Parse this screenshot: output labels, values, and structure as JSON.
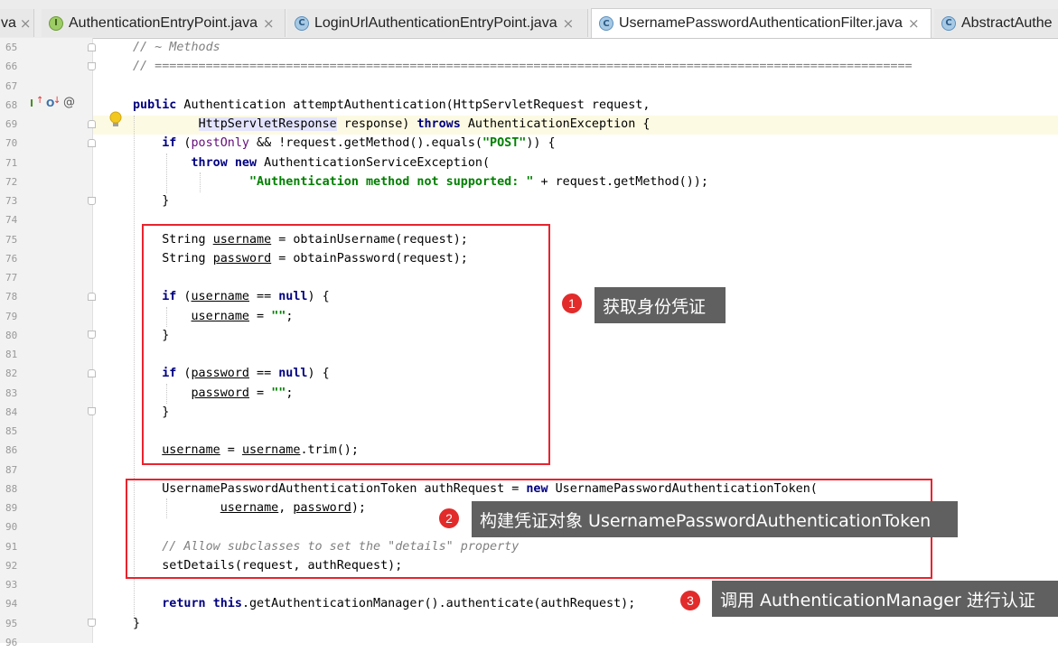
{
  "tabs": [
    {
      "label": "va",
      "icon": "none",
      "active": false
    },
    {
      "label": "AuthenticationEntryPoint.java",
      "icon": "interface-icon",
      "icon_letter": "I",
      "active": false
    },
    {
      "label": "LoginUrlAuthenticationEntryPoint.java",
      "icon": "class-icon",
      "icon_letter": "C",
      "active": false
    },
    {
      "label": "UsernamePasswordAuthenticationFilter.java",
      "icon": "class-icon",
      "icon_letter": "C",
      "active": true
    },
    {
      "label": "AbstractAuthe",
      "icon": "class-icon",
      "icon_letter": "C",
      "active": false
    }
  ],
  "close_glyph": "×",
  "line_numbers": [
    "65",
    "66",
    "67",
    "68",
    "69",
    "70",
    "71",
    "72",
    "73",
    "74",
    "75",
    "76",
    "77",
    "78",
    "79",
    "80",
    "81",
    "82",
    "83",
    "84",
    "85",
    "86",
    "87",
    "88",
    "89",
    "90",
    "91",
    "92",
    "93",
    "94",
    "95",
    "96"
  ],
  "gutter_icons": {
    "implements": "I",
    "override": "O",
    "annotation": "@"
  },
  "code": {
    "l65": "// ~ Methods",
    "l66": "// ========================================================================================================",
    "l68_kw": "public",
    "l68_rest": " Authentication attemptAuthentication(HttpServletRequest request,",
    "l69_type": "HttpServletResponse",
    "l69_mid": " response) ",
    "l69_kw": "throws",
    "l69_rest": " AuthenticationException {",
    "l70_kw": "if",
    "l70_a": " (",
    "l70_fld": "postOnly",
    "l70_b": " && !request.getMethod().equals(",
    "l70_str": "\"POST\"",
    "l70_c": ")) {",
    "l71_kw1": "throw",
    "l71_kw2": "new",
    "l71_rest": " AuthenticationServiceException(",
    "l72_str": "\"Authentication method not supported: \"",
    "l72_rest": " + request.getMethod());",
    "l73": "}",
    "l75_a": "String ",
    "l75_var": "username",
    "l75_b": " = obtainUsername(request);",
    "l76_a": "String ",
    "l76_var": "password",
    "l76_b": " = obtainPassword(request);",
    "l78_kw": "if",
    "l78_a": " (",
    "l78_var": "username",
    "l78_b": " == ",
    "l78_null": "null",
    "l78_c": ") {",
    "l79_var": "username",
    "l79_b": " = ",
    "l79_str": "\"\"",
    "l79_c": ";",
    "l80": "}",
    "l82_kw": "if",
    "l82_a": " (",
    "l82_var": "password",
    "l82_b": " == ",
    "l82_null": "null",
    "l82_c": ") {",
    "l83_var": "password",
    "l83_b": " = ",
    "l83_str": "\"\"",
    "l83_c": ";",
    "l84": "}",
    "l86_var1": "username",
    "l86_b": " = ",
    "l86_var2": "username",
    "l86_c": ".trim();",
    "l88_a": "UsernamePasswordAuthenticationToken authRequest = ",
    "l88_kw": "new",
    "l88_b": " UsernamePasswordAuthenticationToken(",
    "l89_var1": "username",
    "l89_b": ", ",
    "l89_var2": "password",
    "l89_c": ");",
    "l91": "// Allow subclasses to set the \"details\" property",
    "l92": "setDetails(request, authRequest);",
    "l94_kw1": "return",
    "l94_kw2": "this",
    "l94_rest": ".getAuthenticationManager().authenticate(authRequest);",
    "l95": "}"
  },
  "annotations": [
    {
      "number": "1",
      "text": "获取身份凭证"
    },
    {
      "number": "2",
      "text": "构建凭证对象 UsernamePasswordAuthenticationToken"
    },
    {
      "number": "3",
      "text": "调用 AuthenticationManager 进行认证"
    }
  ],
  "colors": {
    "annotation_box": "#e8232e",
    "badge": "#e22b2b",
    "callout_bg": "#606060",
    "keyword": "#000080",
    "string": "#008000",
    "comment": "#808080"
  }
}
